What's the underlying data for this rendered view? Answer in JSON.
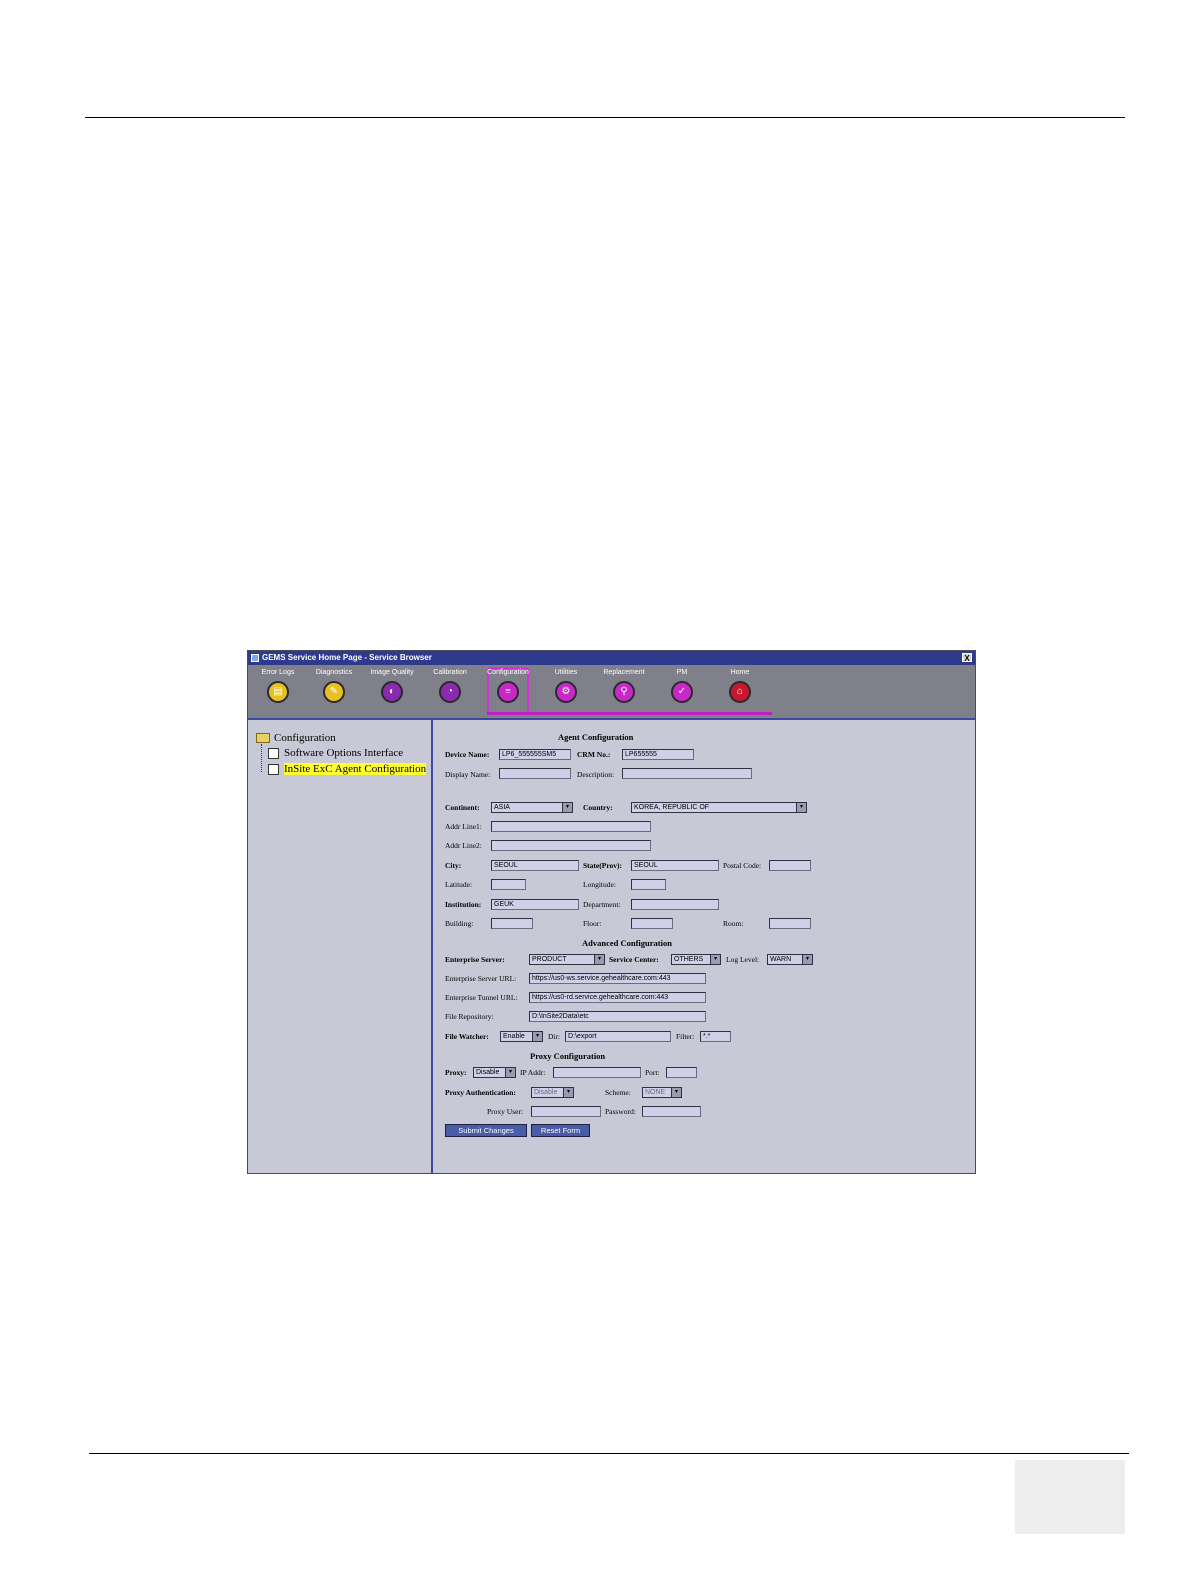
{
  "window": {
    "title": "GEMS Service Home Page - Service Browser",
    "close_label": "X"
  },
  "toolbar": {
    "tabs": [
      {
        "label": "Error Logs",
        "color": "#e8c020",
        "glyph": "▤"
      },
      {
        "label": "Diagnostics",
        "color": "#e8c020",
        "glyph": "✎"
      },
      {
        "label": "Image Quality",
        "color": "#8a2ab0",
        "glyph": "◐"
      },
      {
        "label": "Calibration",
        "color": "#8a2ab0",
        "glyph": "◔"
      },
      {
        "label": "Configuration",
        "color": "#c828c8",
        "glyph": "≡"
      },
      {
        "label": "Utilities",
        "color": "#c828c8",
        "glyph": "⚙"
      },
      {
        "label": "Replacement",
        "color": "#c828c8",
        "glyph": "⚲"
      },
      {
        "label": "PM",
        "color": "#c828c8",
        "glyph": "✓"
      },
      {
        "label": "Home",
        "color": "#c81830",
        "glyph": "⌂"
      }
    ],
    "active_tab": "Configuration"
  },
  "tree": {
    "root": "Configuration",
    "items": [
      "Software Options Interface",
      "InSite ExC Agent Configuration"
    ],
    "selected": "InSite ExC Agent Configuration"
  },
  "form": {
    "agent_title": "Agent Configuration",
    "device_name_label": "Device Name:",
    "device_name": "LP6_555555SM5",
    "crm_label": "CRM No.:",
    "crm": "LP655555",
    "display_name_label": "Display Name:",
    "display_name": "",
    "description_label": "Description:",
    "description": "",
    "continent_label": "Continent:",
    "continent": "ASIA",
    "country_label": "Country:",
    "country": "KOREA, REPUBLIC OF",
    "addr1_label": "Addr Line1:",
    "addr1": "",
    "addr2_label": "Addr Line2:",
    "addr2": "",
    "city_label": "City:",
    "city": "SEOUL",
    "state_label": "State(Prov):",
    "state": "SEOUL",
    "postal_label": "Postal Code:",
    "postal": "",
    "latitude_label": "Latitude:",
    "latitude": "",
    "longitude_label": "Longitude:",
    "longitude": "",
    "institution_label": "Institution:",
    "institution": "GEUK",
    "department_label": "Department:",
    "department": "",
    "building_label": "Building:",
    "building": "",
    "floor_label": "Floor:",
    "floor": "",
    "room_label": "Room:",
    "room": "",
    "advanced_title": "Advanced Configuration",
    "enterprise_server_label": "Enterprise Server:",
    "enterprise_server": "PRODUCT",
    "service_center_label": "Service Center:",
    "service_center": "OTHERS",
    "log_level_label": "Log Level:",
    "log_level": "WARN",
    "server_url_label": "Enterprise Server URL:",
    "server_url": "https://us0-ws.service.gehealthcare.com:443",
    "tunnel_url_label": "Enterprise Tunnel URL:",
    "tunnel_url": "https://us0-rd.service.gehealthcare.com:443",
    "file_repo_label": "File Repository:",
    "file_repo": "D:\\InSite2Data\\etc",
    "file_watcher_label": "File Watcher:",
    "file_watcher": "Enable",
    "dir_label": "Dir:",
    "dir": "D:\\export",
    "filter_label": "Filter:",
    "filter": "*.*",
    "proxy_title": "Proxy Configuration",
    "proxy_label": "Proxy:",
    "proxy": "Disable",
    "ip_label": "IP Addr:",
    "ip": "",
    "port_label": "Port:",
    "port": "",
    "proxy_auth_label": "Proxy Authentication:",
    "proxy_auth": "Disable",
    "scheme_label": "Scheme:",
    "scheme": "NONE",
    "proxy_user_label": "Proxy User:",
    "proxy_user": "",
    "password_label": "Password:",
    "password": "",
    "submit_label": "Submit Changes",
    "reset_label": "Reset Form"
  }
}
